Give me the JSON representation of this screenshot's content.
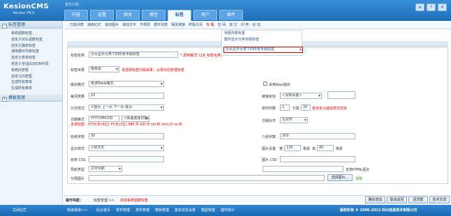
{
  "app": {
    "logo": "KesionCMS",
    "version": "Version V9.5",
    "notice": "官方公告："
  },
  "main_tabs": [
    {
      "label": "内容"
    },
    {
      "label": "设置"
    },
    {
      "label": "相关"
    },
    {
      "label": "模型"
    },
    {
      "label": "标签"
    },
    {
      "label": "用户"
    },
    {
      "label": "插件"
    }
  ],
  "top_tools": [
    "≡",
    "?",
    "✕"
  ],
  "sidebar": {
    "section1": "标签管理",
    "items": [
      "系统函数标签",
      "自定义SQL函数标签",
      "自定义静态标签",
      "通用循环列表标签",
      "自定义表单标签",
      "自定义全站JS/JSON代码",
      "系统JS管理",
      "自定义JS管理",
      "生成所有菜单",
      "生成所有菜单"
    ],
    "section2": "模板管理"
  },
  "topnav": [
    "万能列表",
    "通用幻灯",
    "滚动图片",
    "滚动文字",
    "不规则",
    "循环列表",
    "相关链接",
    "终极分页",
    "专 题",
    "空 间",
    "其 它",
    "问 吧",
    "论 坛"
  ],
  "dropdown": {
    "items": [
      "专题列表标签",
      "循环显示分类专题标签"
    ],
    "selected": "分页显示分类下的所有专题标签"
  },
  "form": {
    "name_label": "标签名称",
    "name_value": "分页显示分类下的所有专题标签",
    "name_hint": "* 调用格式\"{LB_标签名称}\"",
    "dir_label": "标签目录",
    "dir_value": "根目录",
    "dir_hint": "请选择标签归属目录，以便日后管理标签",
    "out_label": "输出格式",
    "out_value": "普通Table格式",
    "ajax_label": "采用Ajax输出",
    "perpage_label": "每页数量",
    "perpage_value": "10",
    "target_label": "链接目标",
    "target_value": "<没有设置>",
    "pagestyle_label": "分页样式",
    "pagestyle_value": "①首页 上一页 下一页 尾页",
    "cols_label": "排列列数",
    "cols_value": "1",
    "rowgap_label": "行距",
    "rowgap_value": "20",
    "cols_hint": "若自定义输出样式无效",
    "date_label": "日期格式",
    "date_value": "YYYY-MM-DD",
    "date_quick": "<快速选择日期>",
    "date_hint": "支持标签：YYYY:年(4位) YY:年(2位) MM:月 DD:日 hh:时 mm:分 ss:秒",
    "align_label": "日期对齐",
    "align_value": "左对齐",
    "namechars_label": "名称字数",
    "namechars_value": "30",
    "introchars_label": "介绍字数",
    "introchars_value": "200",
    "display_label": "显示样式",
    "display_value": "①样式式",
    "imgset_label": "图片设置",
    "width_label": "宽",
    "width_value": "130",
    "px1": "像素",
    "height_label": "高",
    "height_value": "90",
    "px2": "像素",
    "namecss_label": "名称 CSS",
    "imgcss_label": "图片 CSS",
    "navtype_label": "导航类型",
    "navtype_value": "文字导航",
    "html_hint": "支持HTML语法",
    "sepimg_label": "分隔图片",
    "choose_label": "选择图片...",
    "clear_label": "清除"
  },
  "opnav": {
    "label": "操作导航：",
    "crumb": "标签管理 >>",
    "current": "添加系统函数标签",
    "buttons": [
      "确定增加",
      "取消返回",
      "回顶部",
      "技术交流"
    ]
  },
  "footer": {
    "left": "关闭左栏",
    "quick_label": "快速通道>>：",
    "links": [
      "后台首页",
      "发布管理",
      "发布管理",
      "模板管理",
      "基本信息设置",
      "模型管理",
      "插件统计"
    ],
    "copyright": "版权所有 © 2006-2013 科兴信息技术有限公司"
  }
}
